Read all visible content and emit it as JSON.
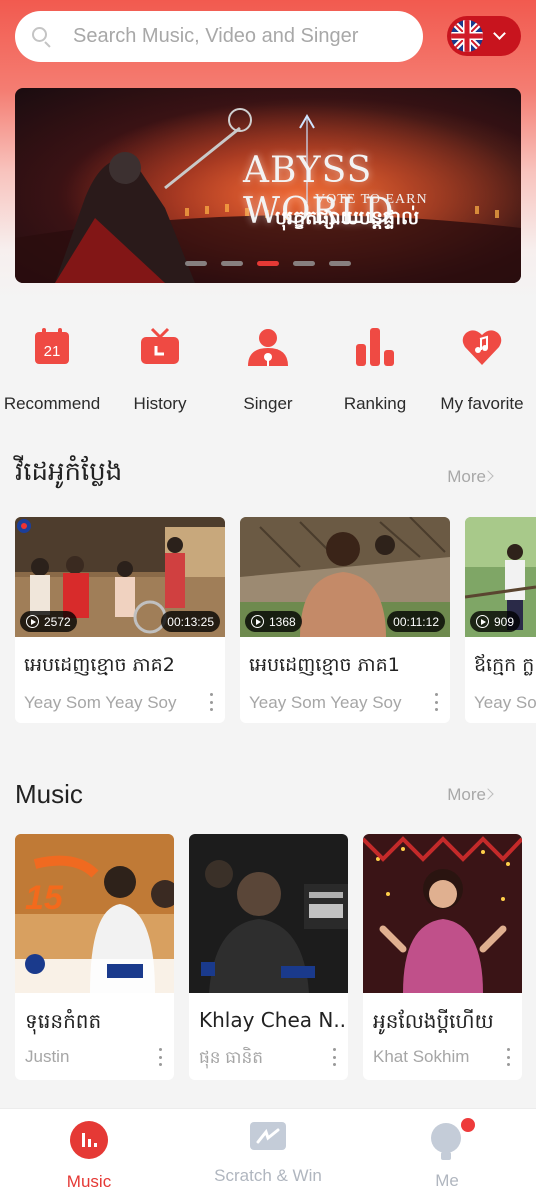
{
  "search": {
    "placeholder": "Search Music, Video and Singer"
  },
  "banner": {
    "title": "ABYSS WORLD",
    "tagline": "VOTE TO EARN",
    "khmer_text": "បុរក្ខតផ្សាយបន្តផ្ទាល់",
    "slides_count": 5,
    "active_slide": 3
  },
  "categories": [
    {
      "label": "Recommend",
      "icon": "calendar-icon",
      "icon_text": "21"
    },
    {
      "label": "History",
      "icon": "tv-icon"
    },
    {
      "label": "Singer",
      "icon": "singer-icon"
    },
    {
      "label": "Ranking",
      "icon": "ranking-icon"
    },
    {
      "label": "My favorite",
      "icon": "heart-music-icon"
    }
  ],
  "videos_section": {
    "title": "វីដេអូកំប្លែង",
    "more": "More",
    "items": [
      {
        "title": "អេបដេញខ្មោច ភាគ2",
        "subtitle": "Yeay Som Yeay Soy",
        "views": "2572",
        "duration": "00:13:25"
      },
      {
        "title": "អេបដេញខ្មោច ភាគ1",
        "subtitle": "Yeay Som Yeay Soy",
        "views": "1368",
        "duration": "00:11:12"
      },
      {
        "title": "ឪក្មេក ក្ល",
        "subtitle": "Yeay Som",
        "views": "909",
        "duration": ""
      }
    ]
  },
  "music_section": {
    "title": "Music",
    "more": "More",
    "items": [
      {
        "title": "ទុរេនកំពត",
        "subtitle": "Justin"
      },
      {
        "title": "Khlay Chea N...",
        "subtitle": "ផុន ធានិត"
      },
      {
        "title": "អូនលែងប្តីហើយ",
        "subtitle": "Khat Sokhim"
      }
    ]
  },
  "bottom_nav": [
    {
      "label": "Music",
      "icon": "music-bars-icon",
      "active": true
    },
    {
      "label": "Scratch & Win",
      "icon": "scratch-card-icon",
      "active": false
    },
    {
      "label": "Me",
      "icon": "profile-icon",
      "active": false,
      "badge": true
    }
  ],
  "colors": {
    "accent": "#e53935",
    "header_red": "#f25a4f",
    "lang_button": "#c8141e"
  }
}
